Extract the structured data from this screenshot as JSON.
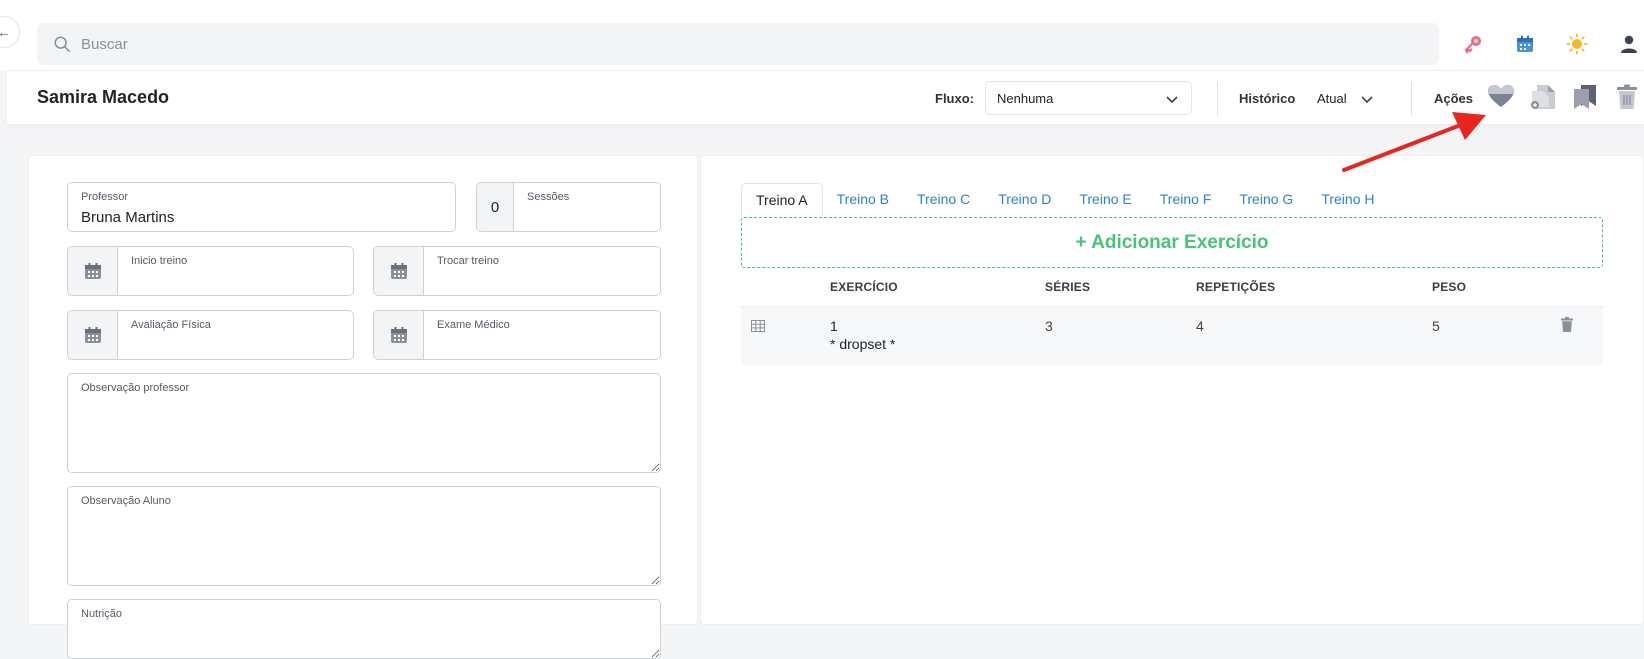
{
  "search": {
    "placeholder": "Buscar"
  },
  "top_icons": [
    "key-icon",
    "calendar-icon",
    "sun-icon",
    "user-icon"
  ],
  "header": {
    "student_name": "Samira Macedo",
    "fluxo_label": "Fluxo:",
    "fluxo_value": "Nenhuma",
    "historico_label": "Histórico",
    "historico_value": "Atual",
    "acoes_label": "Ações"
  },
  "form": {
    "professor_label": "Professor",
    "professor_value": "Bruna Martins",
    "sessoes_count": "0",
    "sessoes_label": "Sessões",
    "inicio_label": "Inicio treino",
    "trocar_label": "Trocar treino",
    "avaliacao_label": "Avaliação Física",
    "exame_label": "Exame Médico",
    "obs_professor_label": "Observação professor",
    "obs_aluno_label": "Observação Aluno",
    "nutricao_label": "Nutrição"
  },
  "workout": {
    "tabs": [
      "Treino A",
      "Treino B",
      "Treino C",
      "Treino D",
      "Treino E",
      "Treino F",
      "Treino G",
      "Treino H"
    ],
    "add_label": "+ Adicionar Exercício",
    "columns": {
      "exercicio": "EXERCÍCIO",
      "series": "SÉRIES",
      "repeticoes": "REPETIÇÕES",
      "peso": "PESO"
    },
    "rows": [
      {
        "exercicio": "1",
        "note": "* dropset *",
        "series": "3",
        "repeticoes": "4",
        "peso": "5"
      }
    ]
  },
  "colors": {
    "accent_blue": "#2f7fd8",
    "add_green": "#49c37a",
    "annotation_red": "#e8261c"
  }
}
